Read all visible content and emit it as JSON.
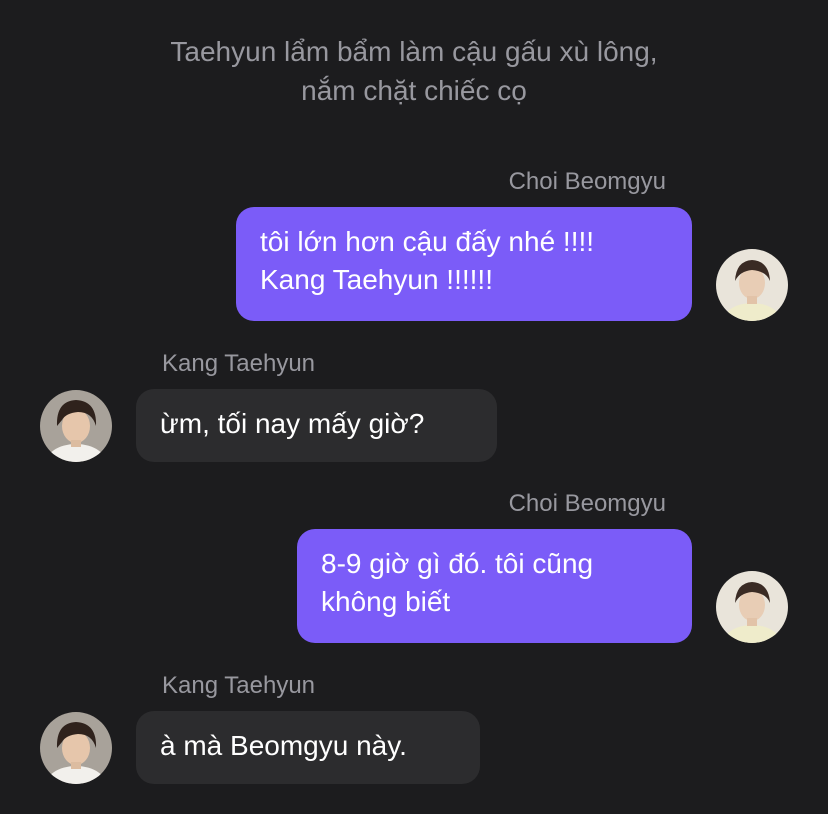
{
  "narration": "Taehyun lẩm bẩm làm cậu gấu xù lông,\nnắm chặt chiếc cọ",
  "messages": [
    {
      "sender": "Choi Beomgyu",
      "side": "right",
      "text": "tôi lớn hơn cậu đấy nhé !!!!\nKang Taehyun !!!!!!"
    },
    {
      "sender": "Kang Taehyun",
      "side": "left",
      "text": "ừm, tối nay mấy giờ?"
    },
    {
      "sender": "Choi Beomgyu",
      "side": "right",
      "text": "8-9 giờ gì đó. tôi cũng\nkhông biết"
    },
    {
      "sender": "Kang Taehyun",
      "side": "left",
      "text": "à mà Beomgyu này."
    }
  ],
  "colors": {
    "background": "#1c1c1e",
    "outgoing_bubble": "#7b5cf8",
    "incoming_bubble": "#2c2c2e",
    "meta_text": "#98989f"
  }
}
